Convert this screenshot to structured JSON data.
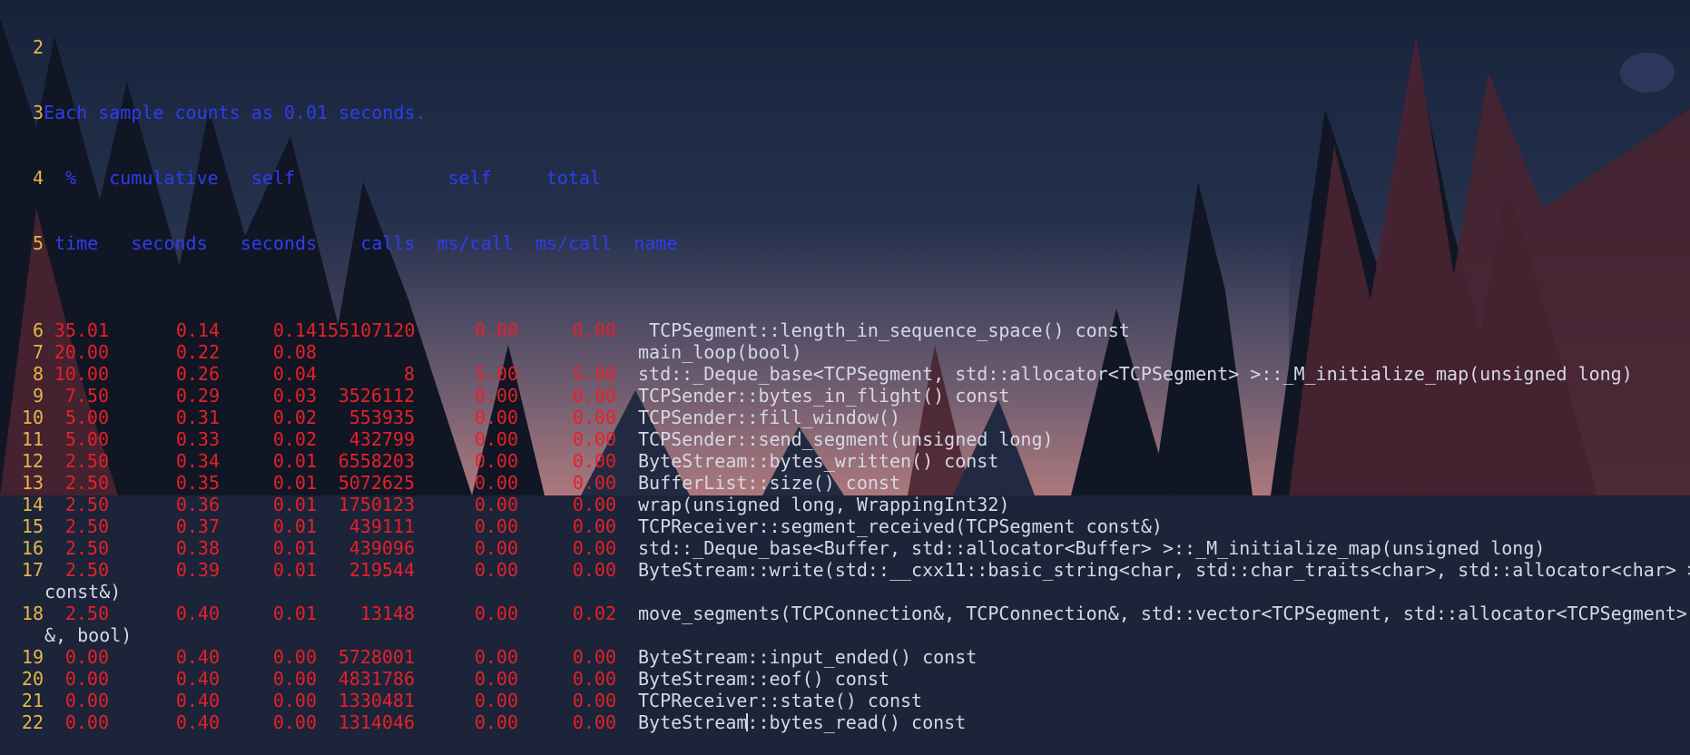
{
  "terminal": {
    "header": {
      "line2": {
        "n": "2",
        "text": ""
      },
      "line3": {
        "n": "3",
        "text": "Each sample counts as 0.01 seconds."
      },
      "line4": {
        "n": "4",
        "text": "  %   cumulative   self              self     total"
      },
      "line5": {
        "n": "5",
        "text": " time   seconds   seconds    calls  ms/call  ms/call  name"
      }
    },
    "rows": [
      {
        "n": "6",
        "time": "35.01",
        "cum": "0.14",
        "self": "0.14",
        "calls": "155107120",
        "self_ms": "0.00",
        "total_ms": "0.00",
        "name": " TCPSegment::length_in_sequence_space() const"
      },
      {
        "n": "7",
        "time": "20.00",
        "cum": "0.22",
        "self": "0.08",
        "calls": "",
        "self_ms": "",
        "total_ms": "",
        "name": "main_loop(bool)"
      },
      {
        "n": "8",
        "time": "10.00",
        "cum": "0.26",
        "self": "0.04",
        "calls": "8",
        "self_ms": "5.00",
        "total_ms": "5.00",
        "name": "std::_Deque_base<TCPSegment, std::allocator<TCPSegment> >::_M_initialize_map(unsigned long)"
      },
      {
        "n": "9",
        "time": "7.50",
        "cum": "0.29",
        "self": "0.03",
        "calls": "3526112",
        "self_ms": "0.00",
        "total_ms": "0.00",
        "name": "TCPSender::bytes_in_flight() const"
      },
      {
        "n": "10",
        "time": "5.00",
        "cum": "0.31",
        "self": "0.02",
        "calls": "553935",
        "self_ms": "0.00",
        "total_ms": "0.00",
        "name": "TCPSender::fill_window()"
      },
      {
        "n": "11",
        "time": "5.00",
        "cum": "0.33",
        "self": "0.02",
        "calls": "432799",
        "self_ms": "0.00",
        "total_ms": "0.00",
        "name": "TCPSender::send_segment(unsigned long)"
      },
      {
        "n": "12",
        "time": "2.50",
        "cum": "0.34",
        "self": "0.01",
        "calls": "6558203",
        "self_ms": "0.00",
        "total_ms": "0.00",
        "name": "ByteStream::bytes_written() const"
      },
      {
        "n": "13",
        "time": "2.50",
        "cum": "0.35",
        "self": "0.01",
        "calls": "5072625",
        "self_ms": "0.00",
        "total_ms": "0.00",
        "name": "BufferList::size() const"
      },
      {
        "n": "14",
        "time": "2.50",
        "cum": "0.36",
        "self": "0.01",
        "calls": "1750123",
        "self_ms": "0.00",
        "total_ms": "0.00",
        "name": "wrap(unsigned long, WrappingInt32)"
      },
      {
        "n": "15",
        "time": "2.50",
        "cum": "0.37",
        "self": "0.01",
        "calls": "439111",
        "self_ms": "0.00",
        "total_ms": "0.00",
        "name": "TCPReceiver::segment_received(TCPSegment const&)"
      },
      {
        "n": "16",
        "time": "2.50",
        "cum": "0.38",
        "self": "0.01",
        "calls": "439096",
        "self_ms": "0.00",
        "total_ms": "0.00",
        "name": "std::_Deque_base<Buffer, std::allocator<Buffer> >::_M_initialize_map(unsigned long)"
      },
      {
        "n": "17",
        "time": "2.50",
        "cum": "0.39",
        "self": "0.01",
        "calls": "219544",
        "self_ms": "0.00",
        "total_ms": "0.00",
        "name": "ByteStream::write(std::__cxx11::basic_string<char, std::char_traits<char>, std::allocator<char> >",
        "cont": "const&)"
      },
      {
        "n": "18",
        "time": "2.50",
        "cum": "0.40",
        "self": "0.01",
        "calls": "13148",
        "self_ms": "0.00",
        "total_ms": "0.02",
        "name": "move_segments(TCPConnection&, TCPConnection&, std::vector<TCPSegment, std::allocator<TCPSegment> >",
        "cont": "&, bool)"
      },
      {
        "n": "19",
        "time": "0.00",
        "cum": "0.40",
        "self": "0.00",
        "calls": "5728001",
        "self_ms": "0.00",
        "total_ms": "0.00",
        "name": "ByteStream::input_ended() const"
      },
      {
        "n": "20",
        "time": "0.00",
        "cum": "0.40",
        "self": "0.00",
        "calls": "4831786",
        "self_ms": "0.00",
        "total_ms": "0.00",
        "name": "ByteStream::eof() const"
      },
      {
        "n": "21",
        "time": "0.00",
        "cum": "0.40",
        "self": "0.00",
        "calls": "1330481",
        "self_ms": "0.00",
        "total_ms": "0.00",
        "name": "TCPReceiver::state() const"
      },
      {
        "n": "22",
        "time": "0.00",
        "cum": "0.40",
        "self": "0.00",
        "calls": "1314046",
        "self_ms": "0.00",
        "total_ms": "0.00",
        "name_a": "ByteStream",
        "name_b": "::bytes_read() const"
      }
    ]
  }
}
